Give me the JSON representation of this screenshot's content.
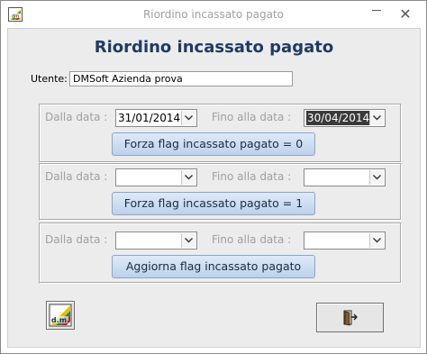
{
  "window": {
    "title": "Riordino incassato pagato"
  },
  "form": {
    "heading": "Riordino incassato pagato",
    "utente_label": "Utente:",
    "utente_value": "DMSoft Azienda prova"
  },
  "sections": [
    {
      "dalla_label": "Dalla data :",
      "dalla_value": "31/01/2014",
      "fino_label": "Fino alla data :",
      "fino_value": "30/04/2014",
      "button_label": "Forza flag incassato pagato = 0"
    },
    {
      "dalla_label": "Dalla data :",
      "dalla_value": "",
      "fino_label": "Fino alla data :",
      "fino_value": "",
      "button_label": "Forza flag incassato pagato = 1"
    },
    {
      "dalla_label": "Dalla data :",
      "dalla_value": "",
      "fino_label": "Fino alla data :",
      "fino_value": "",
      "button_label": "Aggiorna flag incassato pagato"
    }
  ],
  "icons": {
    "app": "dm-logo-icon",
    "logo_button": "dm-logo-icon",
    "exit_button": "exit-door-icon",
    "minimize": "minimize-icon",
    "close": "close-icon",
    "dropdown": "chevron-down-icon"
  },
  "colors": {
    "heading": "#1f3a66",
    "button_fill": "#c9daf0",
    "label_gray": "#a0a0a0"
  }
}
